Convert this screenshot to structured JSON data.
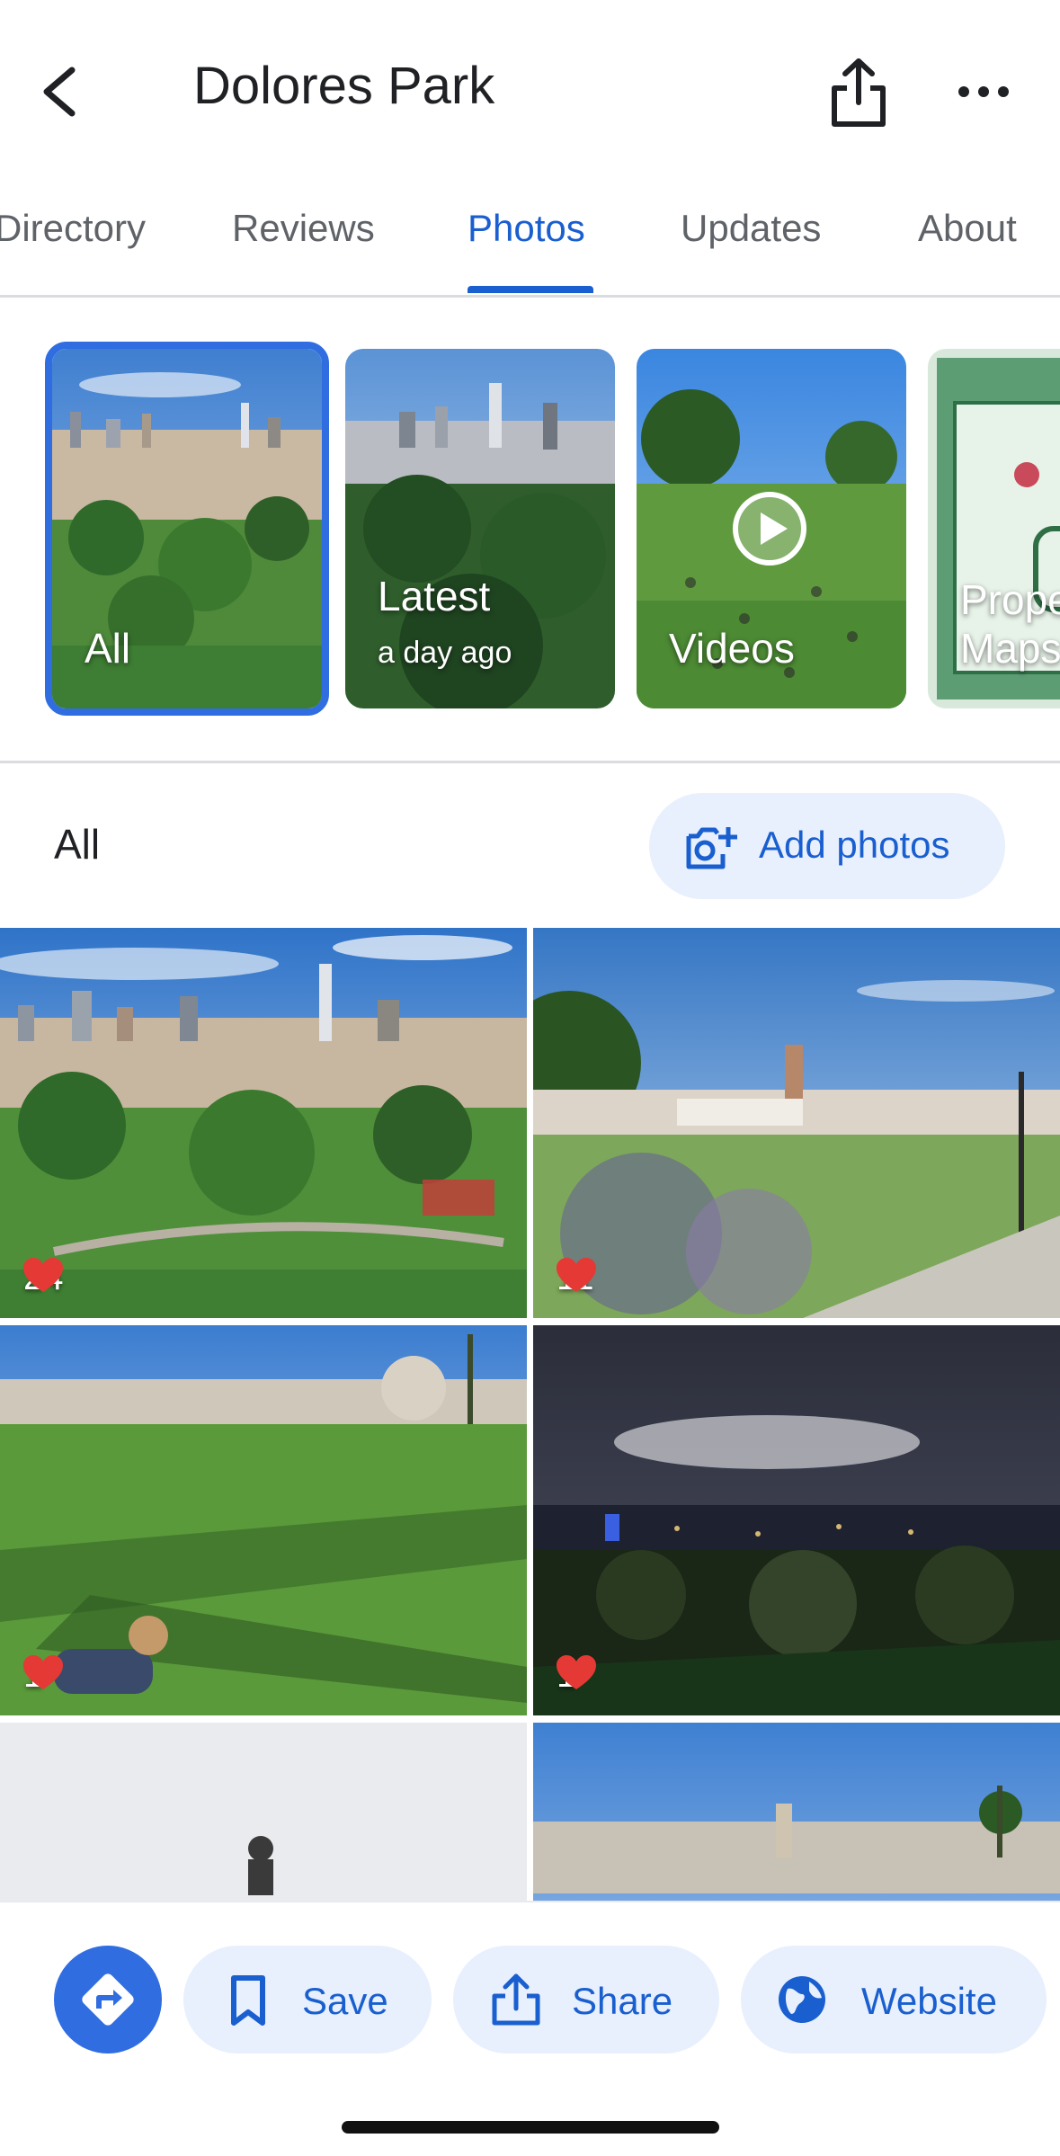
{
  "header": {
    "title": "Dolores Park",
    "back_icon": "chevron-left-icon",
    "share_icon": "share-icon",
    "more_icon": "more-horizontal-icon"
  },
  "tabs": [
    {
      "label": "Directory",
      "active": false
    },
    {
      "label": "Reviews",
      "active": false
    },
    {
      "label": "Photos",
      "active": true
    },
    {
      "label": "Updates",
      "active": false
    },
    {
      "label": "About",
      "active": false
    }
  ],
  "albums": [
    {
      "label": "All",
      "selected": true
    },
    {
      "label": "Latest",
      "sublabel": "a day ago",
      "selected": false
    },
    {
      "label": "Videos",
      "selected": false
    },
    {
      "label": "Prope Maps",
      "line1": "Prope",
      "line2": "Maps",
      "selected": false
    }
  ],
  "section": {
    "title": "All",
    "add_photos_label": "Add photos"
  },
  "photos": [
    {
      "likes": "24",
      "theme": "city-skyline-park"
    },
    {
      "likes": "11",
      "theme": "park-hill-view"
    },
    {
      "likes": "1",
      "theme": "lawn-dog"
    },
    {
      "likes": "1",
      "theme": "night-city"
    },
    {
      "likes": "",
      "theme": "overcast-silhouette"
    },
    {
      "likes": "",
      "theme": "sunny-rooftops"
    }
  ],
  "bottom_bar": {
    "directions_icon": "directions-icon",
    "save_label": "Save",
    "share_label": "Share",
    "website_label": "Website"
  },
  "colors": {
    "accent": "#1a5fcf",
    "pill_bg": "#e8f0fe",
    "fab_bg": "#2f6de1",
    "heart": "#e53935"
  }
}
